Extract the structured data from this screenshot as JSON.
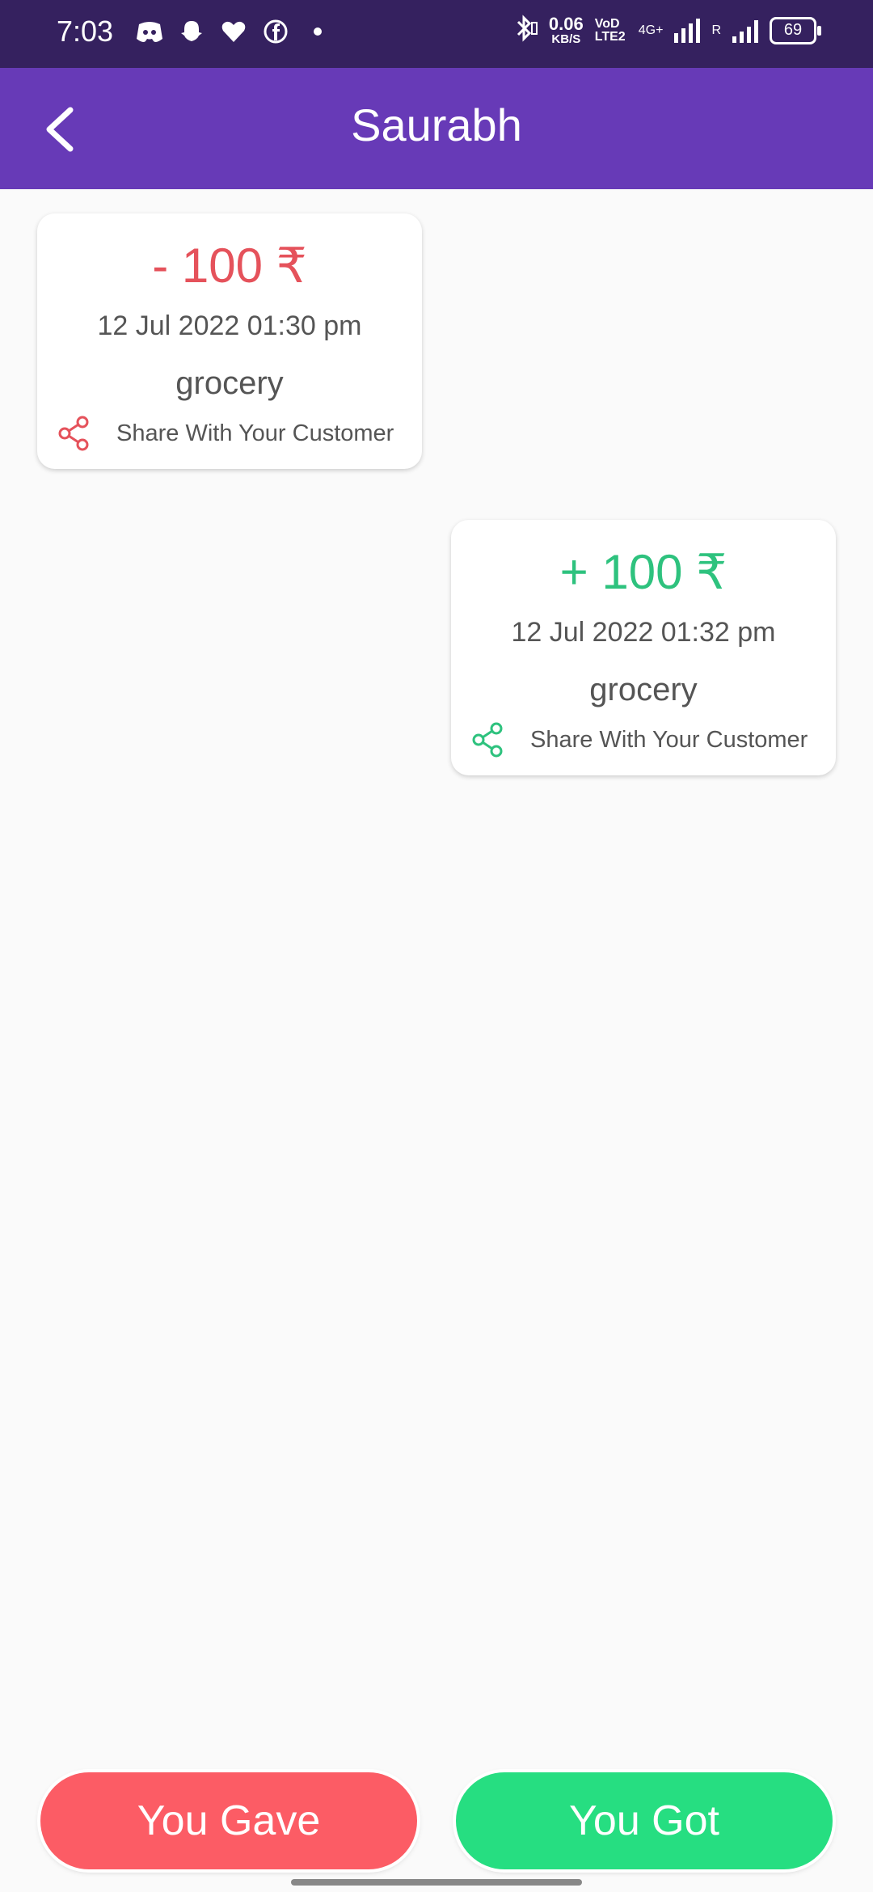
{
  "status_bar": {
    "time": "7:03",
    "speed_value": "0.06",
    "speed_unit": "KB/S",
    "volte": "VoD LTE2",
    "network": "4G+",
    "roaming": "R",
    "battery": "69"
  },
  "header": {
    "title": "Saurabh",
    "back_icon": "chevron-left-icon"
  },
  "transactions": [
    {
      "type": "gave",
      "amount": "- 100 ₹",
      "datetime": "12 Jul 2022 01:30 pm",
      "note": "grocery",
      "share_label": "Share With Your Customer",
      "color": "#e5525b"
    },
    {
      "type": "got",
      "amount": "+ 100 ₹",
      "datetime": "12 Jul 2022 01:32 pm",
      "note": "grocery",
      "share_label": "Share With Your Customer",
      "color": "#2ec27e"
    }
  ],
  "actions": {
    "gave_label": "You Gave",
    "got_label": "You Got",
    "gave_color": "#fc5c65",
    "got_color": "#26de81"
  },
  "colors": {
    "app_bar": "#673ab7",
    "status_bar": "#35215f"
  }
}
